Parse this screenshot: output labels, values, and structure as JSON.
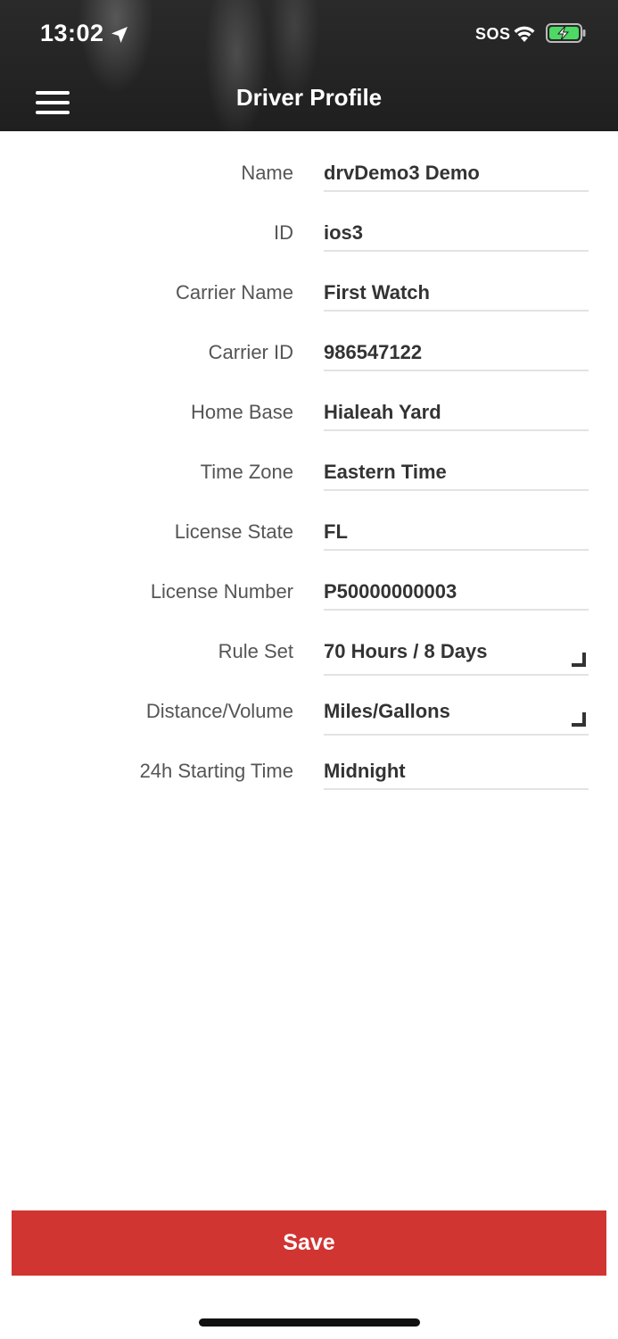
{
  "status_bar": {
    "time": "13:02",
    "sos": "SOS",
    "icons": [
      "location-arrow-icon",
      "wifi-icon",
      "battery-charging-icon"
    ]
  },
  "nav": {
    "title": "Driver Profile",
    "menu_icon": "hamburger-menu-icon"
  },
  "colors": {
    "header_bg": "#1f1f1f",
    "save_bg": "#d13532",
    "label": "#555555",
    "value": "#333333",
    "battery_fill": "#4cd964"
  },
  "fields": [
    {
      "label": "Name",
      "value": "drvDemo3 Demo",
      "type": "text"
    },
    {
      "label": "ID",
      "value": "ios3",
      "type": "text"
    },
    {
      "label": "Carrier Name",
      "value": "First Watch",
      "type": "text"
    },
    {
      "label": "Carrier ID",
      "value": "986547122",
      "type": "text"
    },
    {
      "label": "Home Base",
      "value": "Hialeah Yard",
      "type": "text"
    },
    {
      "label": "Time Zone",
      "value": "Eastern Time",
      "type": "text"
    },
    {
      "label": "License State",
      "value": "FL",
      "type": "text"
    },
    {
      "label": "License Number",
      "value": "P50000000003",
      "type": "text"
    },
    {
      "label": "Rule Set",
      "value": "70 Hours / 8 Days",
      "type": "picker"
    },
    {
      "label": "Distance/Volume",
      "value": "Miles/Gallons",
      "type": "picker"
    },
    {
      "label": "24h Starting Time",
      "value": "Midnight",
      "type": "text"
    }
  ],
  "save_label": "Save"
}
